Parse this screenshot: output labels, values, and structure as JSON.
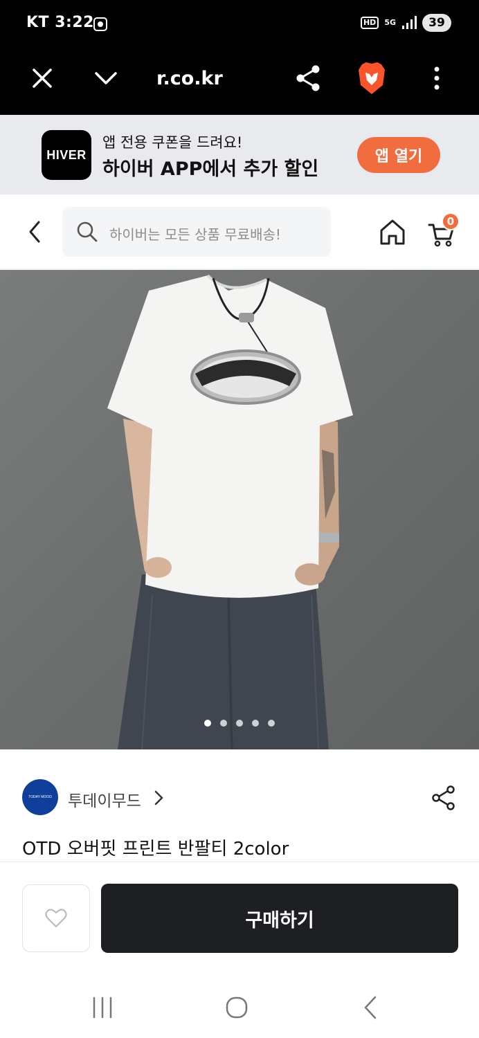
{
  "status_bar": {
    "carrier_time": "KT 3:22",
    "hd": "HD",
    "network": "5G",
    "battery": "39"
  },
  "browser": {
    "url": "r.co.kr"
  },
  "app_banner": {
    "logo_text": "HIVER",
    "subtitle": "앱 전용 쿠폰을 드려요!",
    "title": "하이버 APP에서 추가 할인",
    "open_button": "앱 열기"
  },
  "header": {
    "search_placeholder": "하이버는 모든 상품 무료배송!",
    "cart_count": "0"
  },
  "product": {
    "image_pages": 5,
    "current_page": 1,
    "brand_logo_text": "TODAY MOOD",
    "brand_name": "투데이무드",
    "title": "OTD 오버핏 프린트 반팔티 2color",
    "buy_button": "구매하기"
  },
  "colors": {
    "accent": "#f26d3d",
    "buy_button_bg": "#1e1f22",
    "banner_bg": "#e9eaee"
  }
}
